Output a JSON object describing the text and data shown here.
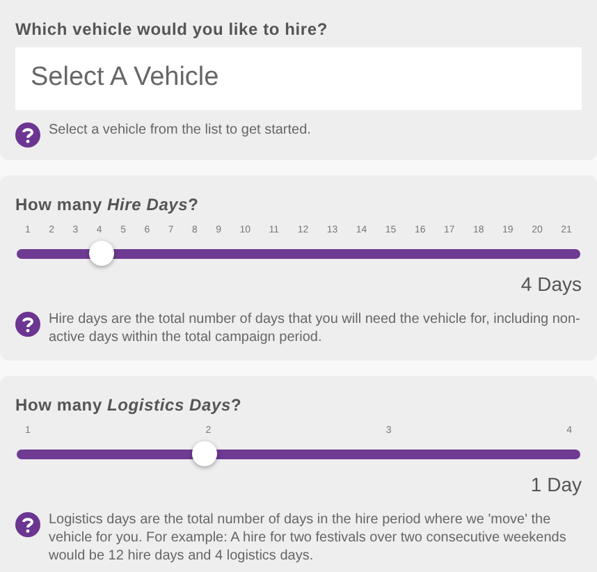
{
  "vehicle": {
    "label": "Which vehicle would you like to hire?",
    "placeholder": "Select A Vehicle",
    "help": "Select a vehicle from the list to get started."
  },
  "sliders": [
    {
      "label": "How many *Hire Days*?",
      "ticks": [
        "1",
        "2",
        "3",
        "4",
        "5",
        "6",
        "7",
        "8",
        "9",
        "10",
        "11",
        "12",
        "13",
        "14",
        "15",
        "16",
        "17",
        "18",
        "19",
        "20",
        "21"
      ],
      "level": 0.15,
      "reading": "4 Days",
      "help": "Hire days are the total number of days that you will need the vehicle for, including non-active days within the total campaign period."
    },
    {
      "label": "How many *Logistics Days*?",
      "ticks": [
        "1",
        "2",
        "3",
        "4"
      ],
      "level": 0.3333,
      "reading": "1 Day",
      "help": "Logistics days are the total number of days in the hire period where we 'move' the vehicle for you. For example: A hire for two festivals over two consecutive weekends would be 12 hire days and 4 logistics days."
    }
  ]
}
